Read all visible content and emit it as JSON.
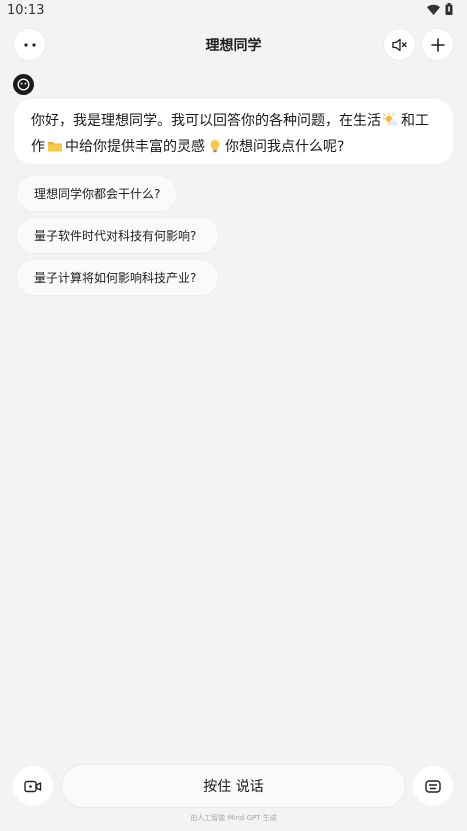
{
  "status_bar": {
    "time": "10:13",
    "icons": [
      "wifi-icon",
      "battery-icon"
    ]
  },
  "header": {
    "title": "理想同学",
    "left_icon": "more-dots-icon",
    "right_icons": [
      "speaker-mute-icon",
      "plus-icon"
    ]
  },
  "assistant": {
    "avatar_icon": "smiley-avatar-icon",
    "greeting": {
      "line1_text": "你好，我是理想同学。我可以回答你的各种问题，在生活",
      "line1_emoji": "sun-cloud-emoji",
      "line1_tail": "和工",
      "line2_head": "作",
      "line2_emoji1": "folder-emoji",
      "line2_mid": "中给你提供丰富的灵感",
      "line2_emoji2": "lightbulb-emoji",
      "line2_tail": "你想问我点什么呢?"
    }
  },
  "suggestions": [
    {
      "label": "理想同学你都会干什么?"
    },
    {
      "label": "量子软件时代对科技有何影响?"
    },
    {
      "label": "量子计算将如何影响科技产业?"
    }
  ],
  "bottom_bar": {
    "video_icon": "video-camera-icon",
    "talk_label": "按住 说话",
    "keyboard_icon": "keyboard-icon",
    "footer": "由人工智能 Mind GPT 生成"
  },
  "colors": {
    "background": "#f3f3f3",
    "surface": "#ffffff",
    "avatar": "#1b1b1b"
  }
}
